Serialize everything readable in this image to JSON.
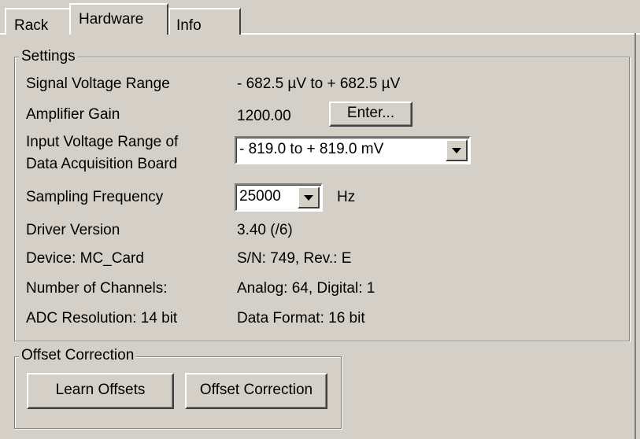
{
  "tabs": [
    {
      "label": "Rack"
    },
    {
      "label": "Hardware"
    },
    {
      "label": "Info"
    }
  ],
  "settings": {
    "title": "Settings",
    "signal_voltage_label": "Signal Voltage Range",
    "signal_voltage_value": "- 682.5 µV to + 682.5 µV",
    "amplifier_gain_label": "Amplifier Gain",
    "amplifier_gain_value": "1200.00",
    "enter_button": "Enter...",
    "input_range_label_line1": "Input Voltage Range of",
    "input_range_label_line2": "Data Acquisition Board",
    "input_range_value": "-  819.0  to +  819.0 mV",
    "sampling_label": "Sampling Frequency",
    "sampling_value": "25000",
    "sampling_unit": "Hz",
    "driver_label": "Driver Version",
    "driver_value": "3.40 (/6)",
    "device_label": "Device: MC_Card",
    "device_value": "S/N: 749, Rev.: E",
    "channels_label": "Number of Channels:",
    "channels_value": "Analog: 64, Digital: 1",
    "adc_label": "ADC Resolution: 14 bit",
    "adc_value": "Data Format: 16 bit"
  },
  "offset": {
    "title": "Offset Correction",
    "learn_button": "Learn Offsets",
    "correction_button": "Offset Correction"
  },
  "icons": {
    "dropdown": "chevron-down-icon"
  }
}
